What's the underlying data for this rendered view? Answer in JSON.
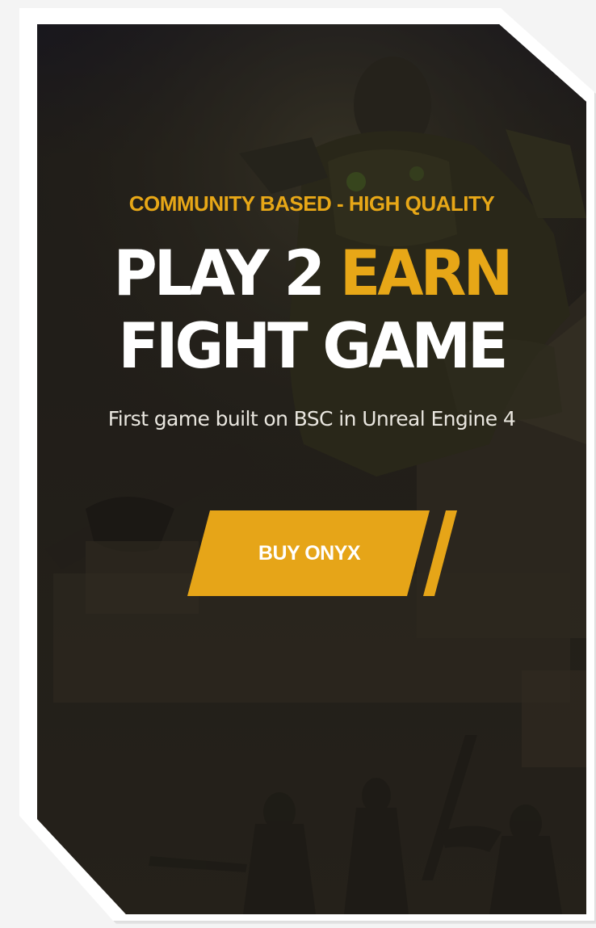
{
  "hero": {
    "tagline": "COMMUNITY BASED - HIGH QUALITY",
    "headline_line1_white": "PLAY 2 ",
    "headline_line1_accent": "EARN",
    "headline_line2": "FIGHT GAME",
    "subtitle": "First game built on BSC in Unreal Engine 4",
    "cta_label": "BUY ONYX"
  },
  "colors": {
    "accent": "#e7a717",
    "button": "#e6a518",
    "background": "#2b2820",
    "text": "#ffffff"
  },
  "background_art": "warrior-battle-scene"
}
